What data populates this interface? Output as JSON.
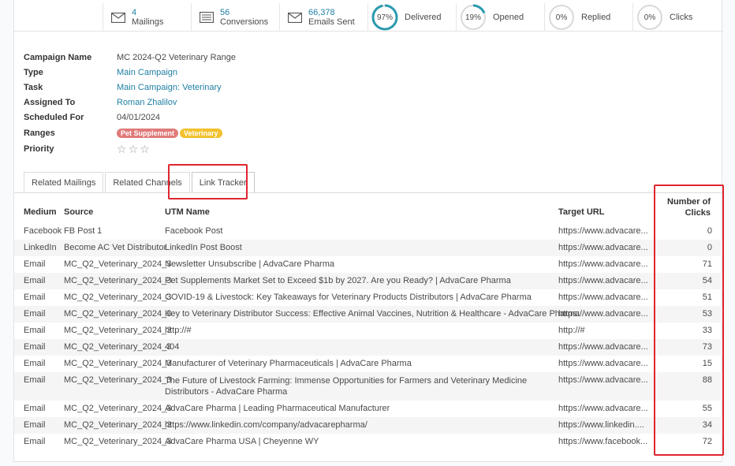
{
  "stats": {
    "mailings": {
      "value": "4",
      "label": "Mailings",
      "icon": "envelope-icon"
    },
    "conversions": {
      "value": "56",
      "label": "Conversions",
      "icon": "list-icon"
    },
    "emails_sent": {
      "value": "66,378",
      "label": "Emails Sent",
      "icon": "envelope-icon"
    },
    "gauges": [
      {
        "percent_text": "97%",
        "percent": 97,
        "label": "Delivered"
      },
      {
        "percent_text": "19%",
        "percent": 19,
        "label": "Opened"
      },
      {
        "percent_text": "0%",
        "percent": 0,
        "label": "Replied"
      },
      {
        "percent_text": "0%",
        "percent": 0,
        "label": "Clicks"
      }
    ],
    "gauge_color": "#2a9aae"
  },
  "form": {
    "campaign_name": {
      "label": "Campaign Name",
      "value": "MC 2024-Q2 Veterinary Range"
    },
    "type": {
      "label": "Type",
      "value": "Main Campaign"
    },
    "task": {
      "label": "Task",
      "value": "Main Campaign: Veterinary"
    },
    "assigned_to": {
      "label": "Assigned To",
      "value": "Roman Zhalilov"
    },
    "scheduled_for": {
      "label": "Scheduled For",
      "value": "04/01/2024"
    },
    "ranges": {
      "label": "Ranges",
      "tags": [
        {
          "text": "Pet Supplement",
          "color": "#e07b7b"
        },
        {
          "text": "Veterinary",
          "color": "#f2c12e"
        }
      ]
    },
    "priority": {
      "label": "Priority",
      "stars": 3,
      "filled": 0
    }
  },
  "tabs": [
    {
      "label": "Related Mailings"
    },
    {
      "label": "Related Channels"
    },
    {
      "label": "Link Tracker",
      "active": true
    }
  ],
  "table": {
    "headers": {
      "medium": "Medium",
      "source": "Source",
      "utm_name": "UTM Name",
      "target_url": "Target URL",
      "clicks_line1": "Number of",
      "clicks_line2": "Clicks"
    },
    "rows": [
      {
        "medium": "Facebook",
        "source": "FB Post 1",
        "utm": "Facebook Post",
        "url": "https://www.advacare...",
        "clicks": "0"
      },
      {
        "medium": "LinkedIn",
        "source": "Become AC Vet Distributor",
        "utm": "LinkedIn Post Boost",
        "url": "https://www.advacare...",
        "clicks": "0"
      },
      {
        "medium": "Email",
        "source": "MC_Q2_Veterinary_2024_3",
        "utm": "Newsletter Unsubscribe | AdvaCare Pharma",
        "url": "https://www.advacare...",
        "clicks": "71"
      },
      {
        "medium": "Email",
        "source": "MC_Q2_Veterinary_2024_3",
        "utm": "Pet Supplements Market Set to Exceed $1b by 2027. Are you Ready? | AdvaCare Pharma",
        "url": "https://www.advacare...",
        "clicks": "54"
      },
      {
        "medium": "Email",
        "source": "MC_Q2_Veterinary_2024_3",
        "utm": "COVID-19 & Livestock: Key Takeaways for Veterinary Products Distributors | AdvaCare Pharma",
        "url": "https://www.advacare...",
        "clicks": "51"
      },
      {
        "medium": "Email",
        "source": "MC_Q2_Veterinary_2024_3",
        "utm": "Key to Veterinary Distributor Success: Effective Animal Vaccines, Nutrition & Healthcare - AdvaCare Pharma",
        "url": "https://www.advacare...",
        "clicks": "53"
      },
      {
        "medium": "Email",
        "source": "MC_Q2_Veterinary_2024_3",
        "utm": "http://#",
        "url": "http://#",
        "clicks": "33"
      },
      {
        "medium": "Email",
        "source": "MC_Q2_Veterinary_2024_3",
        "utm": "404",
        "url": "https://www.advacare...",
        "clicks": "73"
      },
      {
        "medium": "Email",
        "source": "MC_Q2_Veterinary_2024_3",
        "utm": "Manufacturer of Veterinary Pharmaceuticals | AdvaCare Pharma",
        "url": "https://www.advacare...",
        "clicks": "15"
      },
      {
        "medium": "Email",
        "source": "MC_Q2_Veterinary_2024_3",
        "utm": "The Future of Livestock Farming: Immense Opportunities for Farmers and Veterinary Medicine Distributors - AdvaCare Pharma",
        "url": "https://www.advacare...",
        "clicks": "88"
      },
      {
        "medium": "Email",
        "source": "MC_Q2_Veterinary_2024_3",
        "utm": "AdvaCare Pharma | Leading Pharmaceutical Manufacturer",
        "url": "https://www.advacare...",
        "clicks": "55"
      },
      {
        "medium": "Email",
        "source": "MC_Q2_Veterinary_2024_3",
        "utm": "https://www.linkedin.com/company/advacarepharma/",
        "url": "https://www.linkedin....",
        "clicks": "34"
      },
      {
        "medium": "Email",
        "source": "MC_Q2_Veterinary_2024_3",
        "utm": "AdvaCare Pharma USA | Cheyenne WY",
        "url": "https://www.facebook...",
        "clicks": "72"
      }
    ]
  },
  "highlight_color": "#e0262f"
}
